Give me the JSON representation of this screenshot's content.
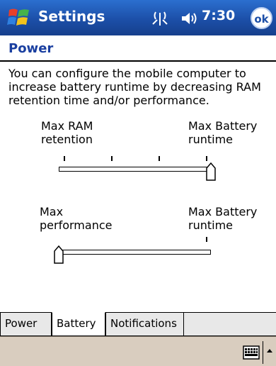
{
  "titlebar": {
    "app_name": "Settings",
    "time": "7:30",
    "ok_label": "ok",
    "icons": [
      "windows-start-icon",
      "antenna-icon",
      "speaker-icon"
    ]
  },
  "page": {
    "heading": "Power",
    "description": "You can configure the mobile computer to increase battery runtime by decreasing RAM retention time and/or performance."
  },
  "sliders": [
    {
      "left_label": "Max RAM\nretention",
      "right_label": "Max Battery\nruntime",
      "level": 1.0
    },
    {
      "left_label": "Max\nperformance",
      "right_label": "Max Battery\nruntime",
      "level": 0.0
    }
  ],
  "tabs": [
    {
      "label": "Power",
      "active": false
    },
    {
      "label": "Battery",
      "active": true
    },
    {
      "label": "Notifications",
      "active": false
    }
  ],
  "menubar": {
    "icons": [
      "keyboard-icon",
      "sip-arrow-icon"
    ]
  },
  "colors": {
    "titlebar": "#1c4fa8",
    "heading": "#1a3fa0",
    "menubar": "#d9cdbf"
  }
}
